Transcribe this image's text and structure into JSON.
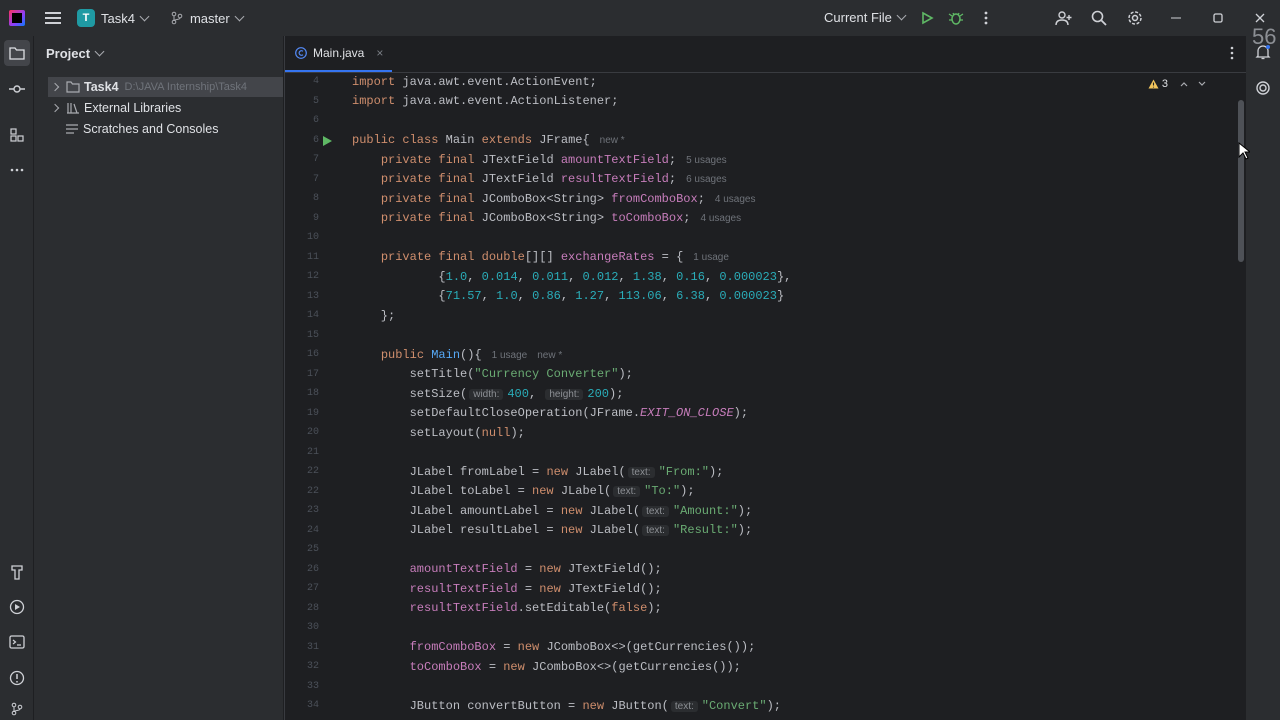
{
  "titlebar": {
    "project_badge": "T",
    "project_name": "Task4",
    "branch": "master",
    "run_config": "Current File"
  },
  "project_panel": {
    "title": "Project",
    "tree": [
      {
        "label": "Task4",
        "path": "D:\\JAVA Internship\\Task4",
        "icon": "folder-icon"
      },
      {
        "label": "External Libraries",
        "path": "",
        "icon": "library-icon"
      },
      {
        "label": "Scratches and Consoles",
        "path": "",
        "icon": "scratches-icon"
      }
    ]
  },
  "editor": {
    "tab_label": "Main.java",
    "tab_close": "×",
    "warnings_count": "3",
    "overlay_text": "56"
  },
  "code": {
    "ln": [
      "4",
      "5",
      "6",
      "6",
      "7",
      "7",
      "8",
      "9",
      "10",
      "11",
      "12",
      "13",
      "14",
      "15",
      "16",
      "17",
      "18",
      "19",
      "20",
      "21",
      "22",
      "22",
      "23",
      "24",
      "25",
      "26",
      "27",
      "28",
      "27",
      "30",
      "31",
      "32",
      "33",
      "34"
    ],
    "hints": {
      "new": "new *",
      "usage5": "5 usages",
      "usage6": "6 usages",
      "usage4": "4 usages",
      "usage1": "1 usage",
      "usage1b": "1 usage"
    },
    "inlays": {
      "width": "width:",
      "height": "height:",
      "text": "text:"
    }
  },
  "colors": {
    "accent": "#3574f0",
    "keyword": "#cf8e6d",
    "string": "#6aab73",
    "number": "#2aacb8",
    "field": "#c77dbb"
  }
}
